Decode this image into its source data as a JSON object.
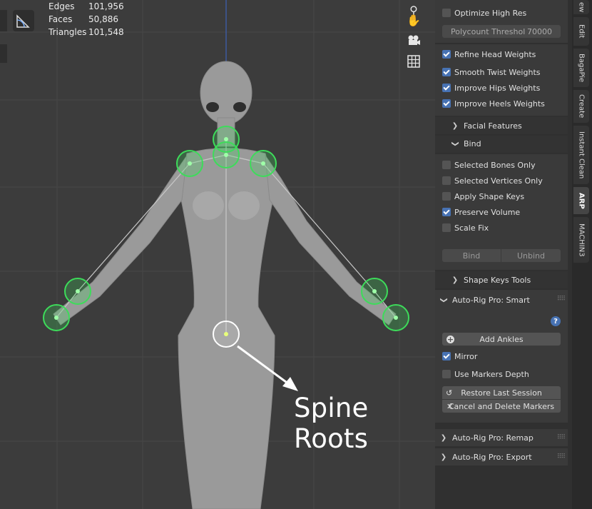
{
  "stats": [
    {
      "label": "Edges",
      "value": "101,956"
    },
    {
      "label": "Faces",
      "value": "50,886"
    },
    {
      "label": "Triangles",
      "value": "101,548"
    }
  ],
  "viewport_icons": [
    "zoom-icon",
    "hand-icon",
    "camera-icon",
    "grid-icon"
  ],
  "annotation": "Spine Roots",
  "panel": {
    "optimize_high_res": {
      "label": "Optimize High Res",
      "checked": false
    },
    "polycount": {
      "label": "Polycount Threshol",
      "value": "70000"
    },
    "weights": [
      {
        "label": "Refine Head Weights",
        "checked": true
      },
      {
        "label": "Smooth Twist Weights",
        "checked": true
      },
      {
        "label": "Improve Hips Weights",
        "checked": true
      },
      {
        "label": "Improve Heels Weights",
        "checked": true
      }
    ],
    "facial_features": "Facial Features",
    "bind_header": "Bind",
    "bind_options": [
      {
        "label": "Selected Bones Only",
        "checked": false
      },
      {
        "label": "Selected Vertices Only",
        "checked": false
      },
      {
        "label": "Apply Shape Keys",
        "checked": false
      },
      {
        "label": "Preserve Volume",
        "checked": true
      },
      {
        "label": "Scale Fix",
        "checked": false
      }
    ],
    "bind_button": "Bind",
    "unbind_button": "Unbind",
    "shape_keys_tools": "Shape Keys Tools",
    "smart_header": "Auto-Rig Pro: Smart",
    "add_ankles": "Add Ankles",
    "mirror": {
      "label": "Mirror",
      "checked": true
    },
    "use_markers_depth": {
      "label": "Use Markers Depth",
      "checked": false
    },
    "restore_last_session": "Restore Last Session",
    "cancel_delete_markers": "Cancel and Delete Markers",
    "remap_header": "Auto-Rig Pro: Remap",
    "export_header": "Auto-Rig Pro: Export"
  },
  "tabs": [
    {
      "label": "ew",
      "active": false
    },
    {
      "label": "Edit",
      "active": false
    },
    {
      "label": "BagaPie",
      "active": false
    },
    {
      "label": "Create",
      "active": false
    },
    {
      "label": "Instant Clean",
      "active": false
    },
    {
      "label": "ARP",
      "active": true
    },
    {
      "label": "MACHIN3",
      "active": false
    }
  ],
  "colors": {
    "accent": "#4772b3",
    "marker": "#3ddc5a",
    "viewport_bg": "#3c3c3c",
    "panel_bg": "#303030"
  }
}
